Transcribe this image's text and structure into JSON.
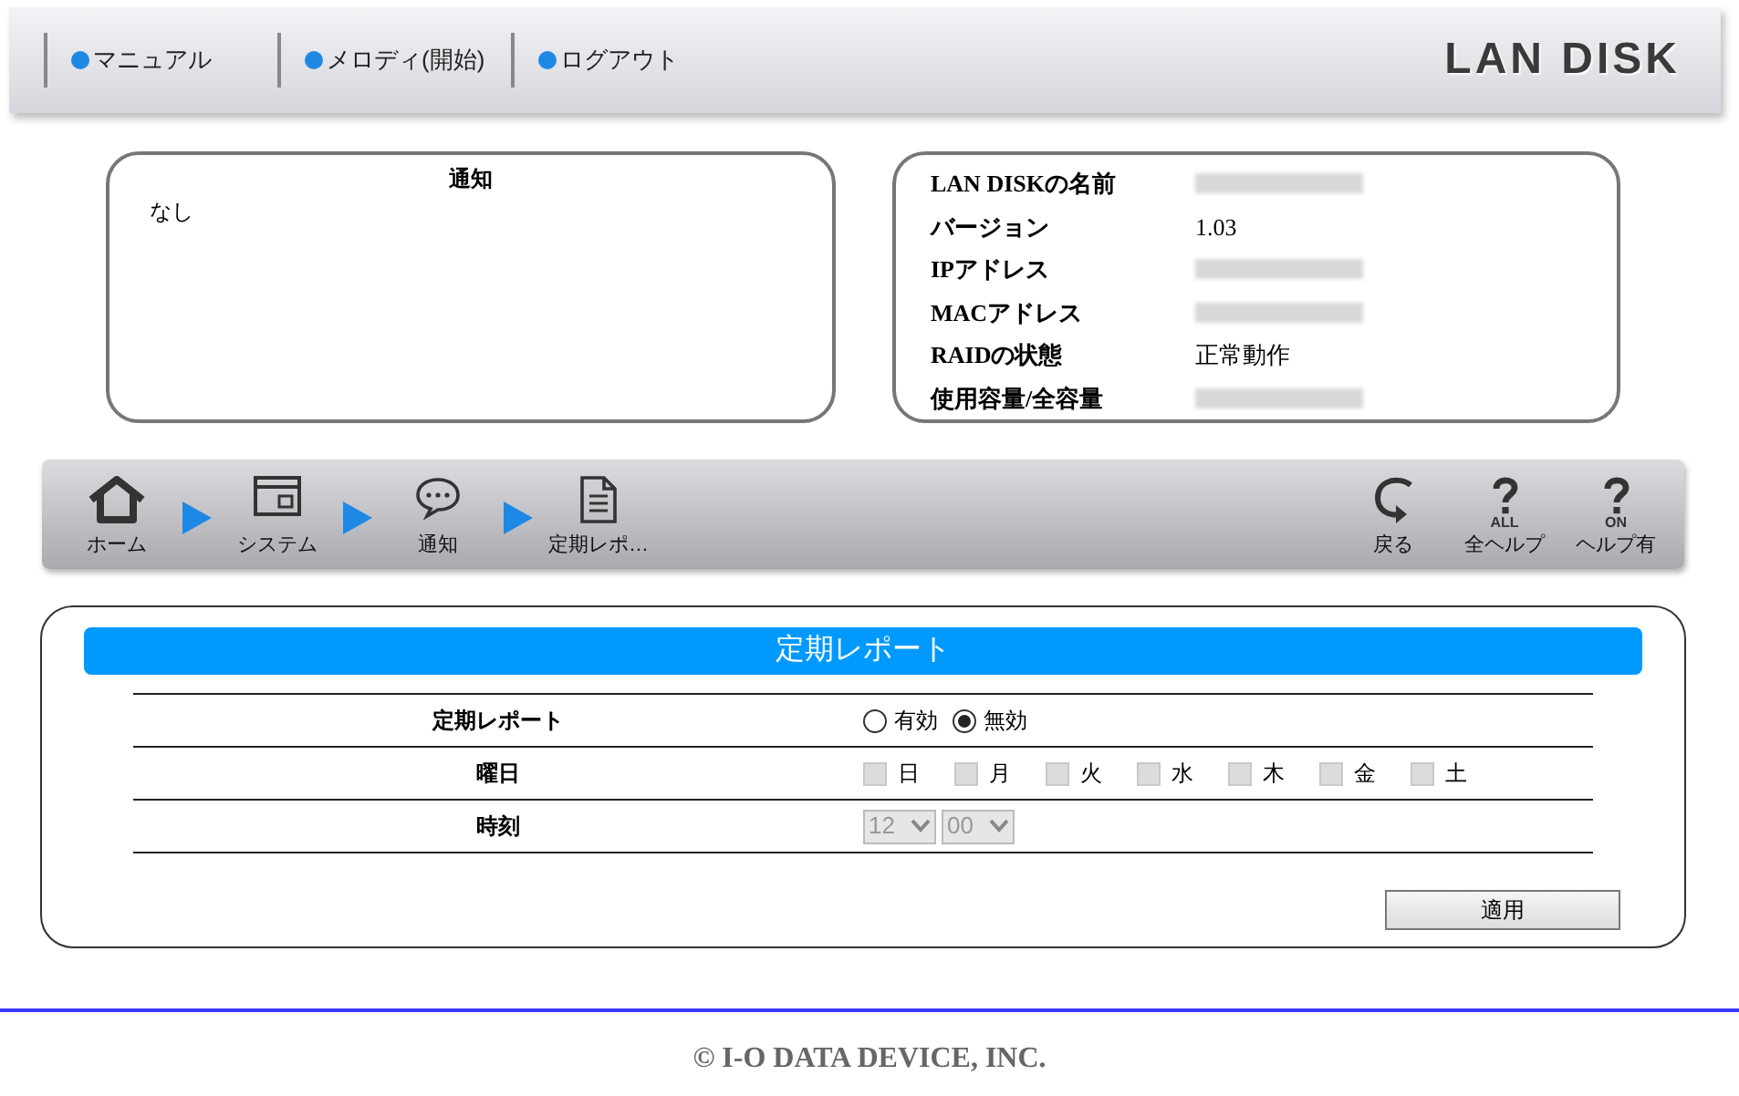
{
  "top_links": [
    "マニュアル",
    "メロディ(開始)",
    "ログアウト"
  ],
  "logo": "LAN DISK",
  "notice": {
    "title": "通知",
    "body": "なし"
  },
  "info": [
    {
      "label": "LAN DISKの名前"
    },
    {
      "label": "バージョン",
      "value": "1.03"
    },
    {
      "label": "IPアドレス"
    },
    {
      "label": "MACアドレス"
    },
    {
      "label": "RAIDの状態",
      "value": "正常動作"
    },
    {
      "label": "使用容量/全容量"
    }
  ],
  "breadcrumb": [
    {
      "kind": "home",
      "label": "ホーム"
    },
    {
      "kind": "window",
      "label": "システム"
    },
    {
      "kind": "chat",
      "label": "通知"
    },
    {
      "kind": "doc",
      "label": "定期レポ…"
    }
  ],
  "tools": [
    {
      "kind": "back",
      "label": "戻る"
    },
    {
      "kind": "help",
      "badge": "ALL",
      "label": "全ヘルプ"
    },
    {
      "kind": "help",
      "badge": "ON",
      "label": "ヘルプ有"
    }
  ],
  "panel": {
    "title": "定期レポート",
    "rows": [
      {
        "kind": "radio",
        "label": "定期レポート",
        "options": [
          {
            "label": "有効",
            "selected": false
          },
          {
            "label": "無効",
            "selected": true
          }
        ]
      },
      {
        "kind": "checks",
        "label": "曜日",
        "options": [
          {
            "label": "日",
            "checked": false,
            "disabled": true
          },
          {
            "label": "月",
            "checked": false,
            "disabled": true
          },
          {
            "label": "火",
            "checked": false,
            "disabled": true
          },
          {
            "label": "水",
            "checked": false,
            "disabled": true
          },
          {
            "label": "木",
            "checked": false,
            "disabled": true
          },
          {
            "label": "金",
            "checked": false,
            "disabled": true
          },
          {
            "label": "土",
            "checked": false,
            "disabled": true
          }
        ]
      },
      {
        "kind": "time",
        "label": "時刻",
        "selects": [
          {
            "value": "12",
            "disabled": true
          },
          {
            "value": "00",
            "disabled": true
          }
        ]
      }
    ],
    "apply": "適用"
  },
  "footer": "© I-O DATA DEVICE, INC."
}
